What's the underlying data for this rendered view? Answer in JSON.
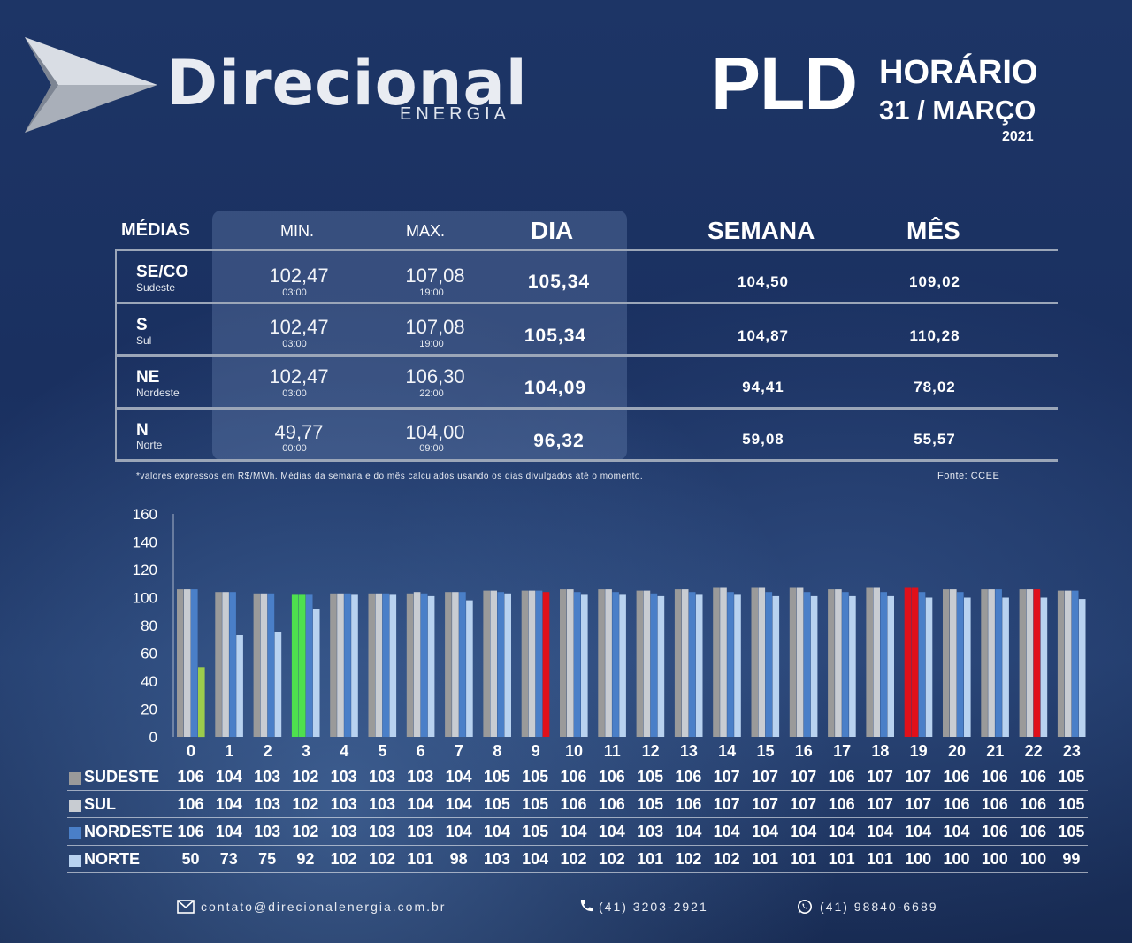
{
  "brand": {
    "name": "Direcional",
    "sub": "ENERGIA"
  },
  "header": {
    "pld": "PLD",
    "horario": "HORÁRIO",
    "date": "31 / MARÇO",
    "year": "2021"
  },
  "table": {
    "headers": {
      "medias": "MÉDIAS",
      "min": "MIN.",
      "max": "MAX.",
      "dia": "DIA",
      "semana": "SEMANA",
      "mes": "MÊS"
    },
    "rows": [
      {
        "code": "SE/CO",
        "name": "Sudeste",
        "min": "102,47",
        "min_time": "03:00",
        "max": "107,08",
        "max_time": "19:00",
        "dia": "105,34",
        "semana": "104,50",
        "mes": "109,02"
      },
      {
        "code": "S",
        "name": "Sul",
        "min": "102,47",
        "min_time": "03:00",
        "max": "107,08",
        "max_time": "19:00",
        "dia": "105,34",
        "semana": "104,87",
        "mes": "110,28"
      },
      {
        "code": "NE",
        "name": "Nordeste",
        "min": "102,47",
        "min_time": "03:00",
        "max": "106,30",
        "max_time": "22:00",
        "dia": "104,09",
        "semana": "94,41",
        "mes": "78,02"
      },
      {
        "code": "N",
        "name": "Norte",
        "min": "49,77",
        "min_time": "00:00",
        "max": "104,00",
        "max_time": "09:00",
        "dia": "96,32",
        "semana": "59,08",
        "mes": "55,57"
      }
    ],
    "note": "*valores expressos em R$/MWh. Médias da semana e do mês  calculados usando os dias divulgados até o momento.",
    "source": "Fonte: CCEE"
  },
  "chart_data": {
    "type": "bar",
    "categories": [
      "0",
      "1",
      "2",
      "3",
      "4",
      "5",
      "6",
      "7",
      "8",
      "9",
      "10",
      "11",
      "12",
      "13",
      "14",
      "15",
      "16",
      "17",
      "18",
      "19",
      "20",
      "21",
      "22",
      "23"
    ],
    "ylim": [
      0,
      160
    ],
    "yticks": [
      0,
      20,
      40,
      60,
      80,
      100,
      120,
      140,
      160
    ],
    "series": [
      {
        "name": "SUDESTE",
        "color": "#9a9a9a",
        "values": [
          106,
          104,
          103,
          102,
          103,
          103,
          103,
          104,
          105,
          105,
          106,
          106,
          105,
          106,
          107,
          107,
          107,
          106,
          107,
          107,
          106,
          106,
          106,
          105
        ]
      },
      {
        "name": "SUL",
        "color": "#c8ccd2",
        "values": [
          106,
          104,
          103,
          102,
          103,
          103,
          104,
          104,
          105,
          105,
          106,
          106,
          105,
          106,
          107,
          107,
          107,
          106,
          107,
          107,
          106,
          106,
          106,
          105
        ]
      },
      {
        "name": "NORDESTE",
        "color": "#4a7fc8",
        "values": [
          106,
          104,
          103,
          102,
          103,
          103,
          103,
          104,
          104,
          105,
          104,
          104,
          103,
          104,
          104,
          104,
          104,
          104,
          104,
          104,
          104,
          106,
          106,
          105
        ]
      },
      {
        "name": "NORTE",
        "color": "#b8d2f0",
        "values": [
          50,
          73,
          75,
          92,
          102,
          102,
          101,
          98,
          103,
          104,
          102,
          102,
          101,
          102,
          102,
          101,
          101,
          101,
          101,
          100,
          100,
          100,
          100,
          99
        ]
      }
    ],
    "highlights": {
      "min_color": "#4ee04e",
      "max_color": "#e0101a",
      "north_min_color": "#9ccc4c"
    }
  },
  "footer": {
    "email": "contato@direcionalenergia.com.br",
    "phone": "(41) 3203-2921",
    "whatsapp": "(41) 98840-6689"
  }
}
